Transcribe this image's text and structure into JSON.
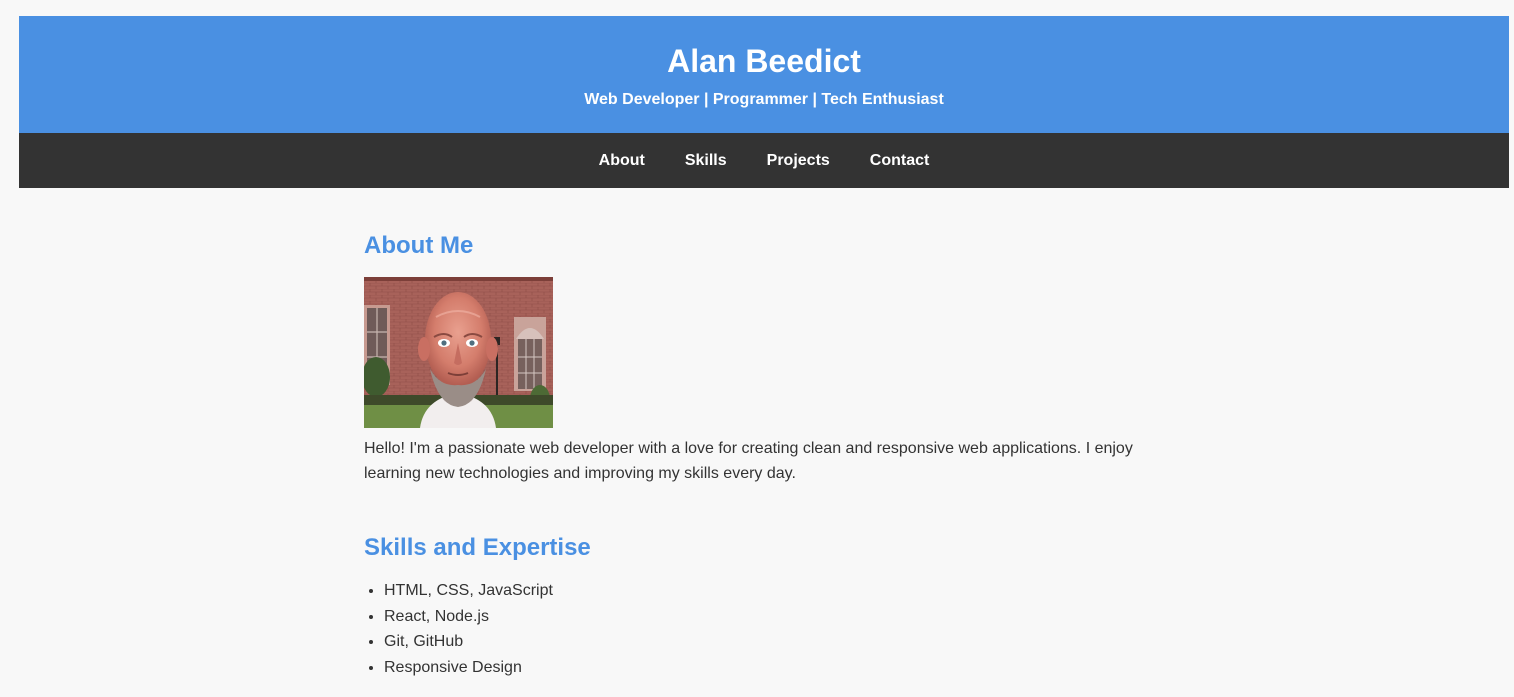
{
  "header": {
    "name": "Alan Beedict",
    "tagline": "Web Developer | Programmer | Tech Enthusiast"
  },
  "nav": {
    "items": [
      {
        "label": "About"
      },
      {
        "label": "Skills"
      },
      {
        "label": "Projects"
      },
      {
        "label": "Contact"
      }
    ]
  },
  "about": {
    "heading": "About Me",
    "photo_alt": "profile-photo",
    "text": "Hello! I'm a passionate web developer with a love for creating clean and responsive web applications. I enjoy learning new technologies and improving my skills every day."
  },
  "skills": {
    "heading": "Skills and Expertise",
    "items": [
      "HTML, CSS, JavaScript",
      "React, Node.js",
      "Git, GitHub",
      "Responsive Design"
    ]
  },
  "colors": {
    "header_bg": "#4a90e2",
    "nav_bg": "#333333",
    "accent": "#4a90e2",
    "page_bg": "#f8f8f8",
    "text": "#333333"
  }
}
